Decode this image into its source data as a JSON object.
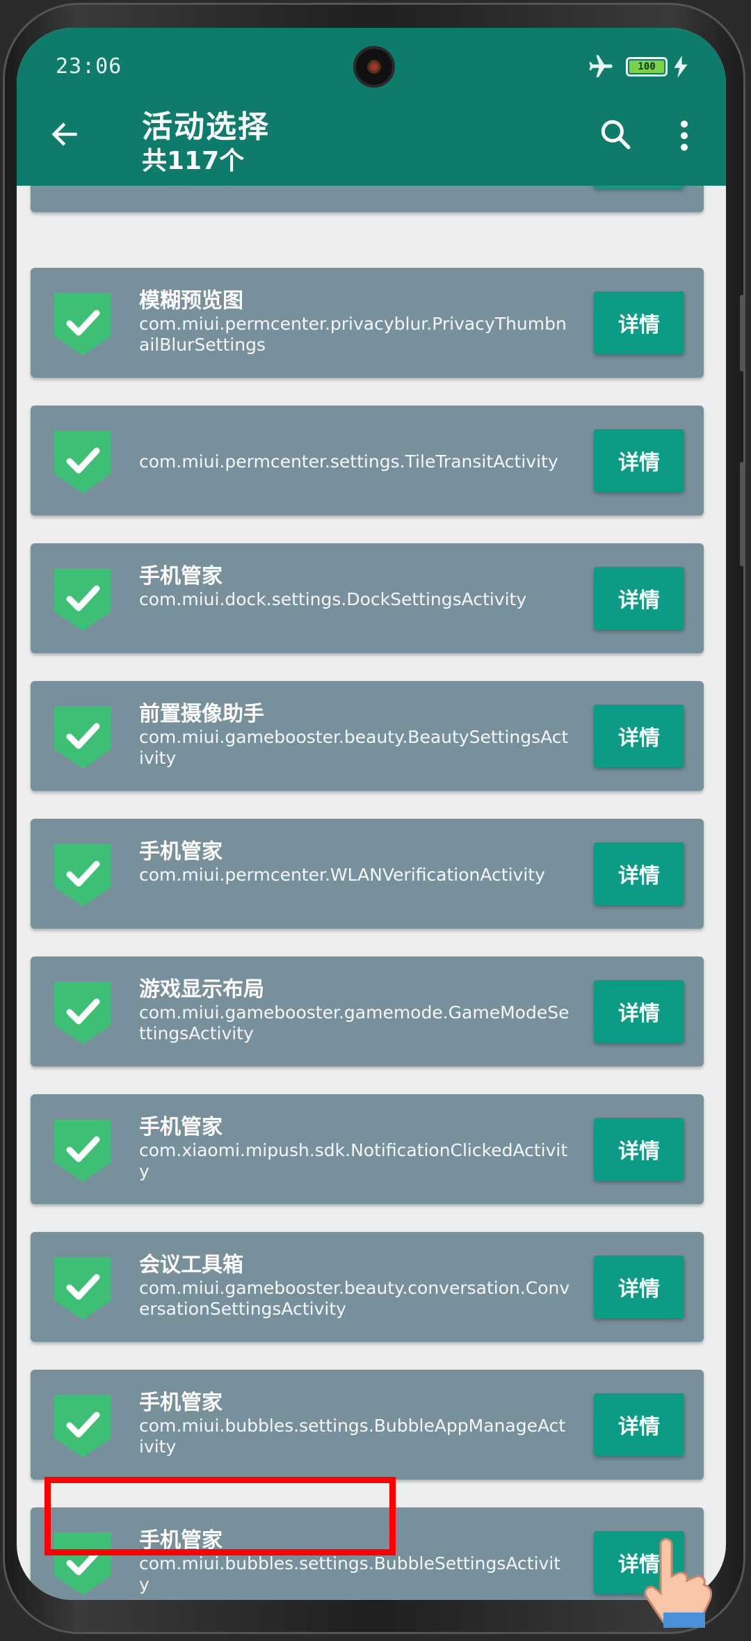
{
  "status_bar": {
    "time": "23:06",
    "battery": "100"
  },
  "header": {
    "title": "活动选择",
    "subtitle": "共117个",
    "back_icon": "arrow-left-icon",
    "search_icon": "search-icon",
    "more_icon": "more-vertical-icon"
  },
  "colors": {
    "app_bar": "#0e7c6b",
    "card": "#78909c",
    "button": "#0c9c86",
    "highlight": "#ff0000",
    "check": "#3dbf75"
  },
  "activities": [
    {
      "title": "模糊预览图",
      "class": "com.miui.permcenter.privacyblur.PrivacyThumbnailBlurSettings",
      "button": "详情"
    },
    {
      "title": "",
      "class": "com.miui.permcenter.settings.TileTransitActivity",
      "button": "详情"
    },
    {
      "title": "手机管家",
      "class": "com.miui.dock.settings.DockSettingsActivity",
      "button": "详情"
    },
    {
      "title": "前置摄像助手",
      "class": "com.miui.gamebooster.beauty.BeautySettingsActivity",
      "button": "详情"
    },
    {
      "title": "手机管家",
      "class": "com.miui.permcenter.WLANVerificationActivity",
      "button": "详情"
    },
    {
      "title": "游戏显示布局",
      "class": "com.miui.gamebooster.gamemode.GameModeSettingsActivity",
      "button": "详情"
    },
    {
      "title": "手机管家",
      "class": "com.xiaomi.mipush.sdk.NotificationClickedActivity",
      "button": "详情"
    },
    {
      "title": "会议工具箱",
      "class": "com.miui.gamebooster.beauty.conversation.ConversationSettingsActivity",
      "button": "详情"
    },
    {
      "title": "手机管家",
      "class": "com.miui.bubbles.settings.BubbleAppManageActivity",
      "button": "详情"
    },
    {
      "title": "手机管家",
      "class": "com.miui.bubbles.settings.BubbleSettingsActivity",
      "button": "详情"
    }
  ]
}
